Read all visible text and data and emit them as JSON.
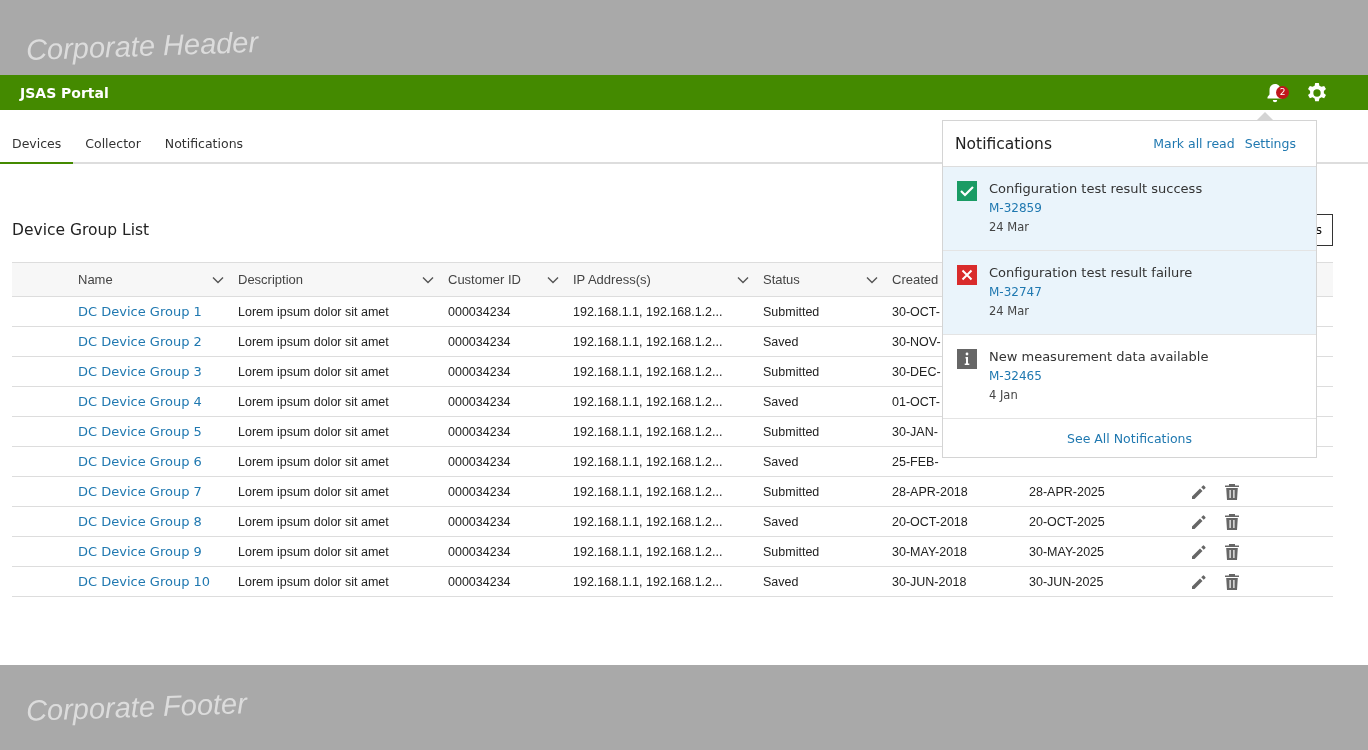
{
  "corporate_header": "Corporate Header",
  "app_bar": {
    "title": "JSAS Portal",
    "notification_count": "2"
  },
  "tabs": [
    {
      "label": "Devices",
      "selected": true
    },
    {
      "label": "Collector",
      "selected": false
    },
    {
      "label": "Notifications",
      "selected": false
    }
  ],
  "page_title": "Device Group List",
  "title_button": "s",
  "table": {
    "columns": [
      {
        "label": "Name",
        "sortable": true
      },
      {
        "label": "Description",
        "sortable": true
      },
      {
        "label": "Customer ID",
        "sortable": true
      },
      {
        "label": "IP Address(s)",
        "sortable": true
      },
      {
        "label": "Status",
        "sortable": true
      },
      {
        "label": "Created",
        "sortable": false
      }
    ],
    "rows": [
      {
        "name": "DC Device Group 1",
        "description": "Lorem ipsum dolor sit amet",
        "customer_id": "000034234",
        "ip": "192.168.1.1, 192.168.1.2...",
        "status": "Submitted",
        "created": "30-OCT-",
        "actions": false
      },
      {
        "name": "DC Device Group 2",
        "description": "Lorem ipsum dolor sit amet",
        "customer_id": "000034234",
        "ip": "192.168.1.1, 192.168.1.2...",
        "status": "Saved",
        "created": "30-NOV-",
        "actions": false
      },
      {
        "name": "DC Device Group 3",
        "description": "Lorem ipsum dolor sit amet",
        "customer_id": "000034234",
        "ip": "192.168.1.1, 192.168.1.2...",
        "status": "Submitted",
        "created": "30-DEC-",
        "actions": false
      },
      {
        "name": "DC Device Group 4",
        "description": "Lorem ipsum dolor sit amet",
        "customer_id": "000034234",
        "ip": "192.168.1.1, 192.168.1.2...",
        "status": "Saved",
        "created": "01-OCT-",
        "actions": false
      },
      {
        "name": "DC Device Group 5",
        "description": "Lorem ipsum dolor sit amet",
        "customer_id": "000034234",
        "ip": "192.168.1.1, 192.168.1.2...",
        "status": "Submitted",
        "created": "30-JAN-",
        "actions": false
      },
      {
        "name": "DC Device Group 6",
        "description": "Lorem ipsum dolor sit amet",
        "customer_id": "000034234",
        "ip": "192.168.1.1, 192.168.1.2...",
        "status": "Saved",
        "created": "25-FEB-",
        "actions": false
      },
      {
        "name": "DC Device Group 7",
        "description": "Lorem ipsum dolor sit amet",
        "customer_id": "000034234",
        "ip": "192.168.1.1, 192.168.1.2...",
        "status": "Submitted",
        "created": "28-APR-2018",
        "modified": "28-APR-2025",
        "actions": true
      },
      {
        "name": "DC Device Group 8",
        "description": "Lorem ipsum dolor sit amet",
        "customer_id": "000034234",
        "ip": "192.168.1.1, 192.168.1.2...",
        "status": "Saved",
        "created": "20-OCT-2018",
        "modified": "20-OCT-2025",
        "actions": true
      },
      {
        "name": "DC Device Group 9",
        "description": "Lorem ipsum dolor sit amet",
        "customer_id": "000034234",
        "ip": "192.168.1.1, 192.168.1.2...",
        "status": "Submitted",
        "created": "30-MAY-2018",
        "modified": "30-MAY-2025",
        "actions": true
      },
      {
        "name": "DC Device Group 10",
        "description": "Lorem ipsum dolor sit amet",
        "customer_id": "000034234",
        "ip": "192.168.1.1, 192.168.1.2...",
        "status": "Saved",
        "created": "30-JUN-2018",
        "modified": "30-JUN-2025",
        "actions": true
      }
    ]
  },
  "notifications_panel": {
    "title": "Notifications",
    "mark_all_read": "Mark all read",
    "settings": "Settings",
    "items": [
      {
        "kind": "success",
        "unread": true,
        "title": "Configuration test result success",
        "reference": "M-32859",
        "date": "24 Mar"
      },
      {
        "kind": "failure",
        "unread": true,
        "title": "Configuration test result failure",
        "reference": "M-32747",
        "date": "24 Mar"
      },
      {
        "kind": "info",
        "unread": false,
        "title": "New measurement data available",
        "reference": "M-32465",
        "date": "4 Jan"
      }
    ],
    "see_all": "See All Notifications"
  },
  "corporate_footer": "Corporate Footer"
}
